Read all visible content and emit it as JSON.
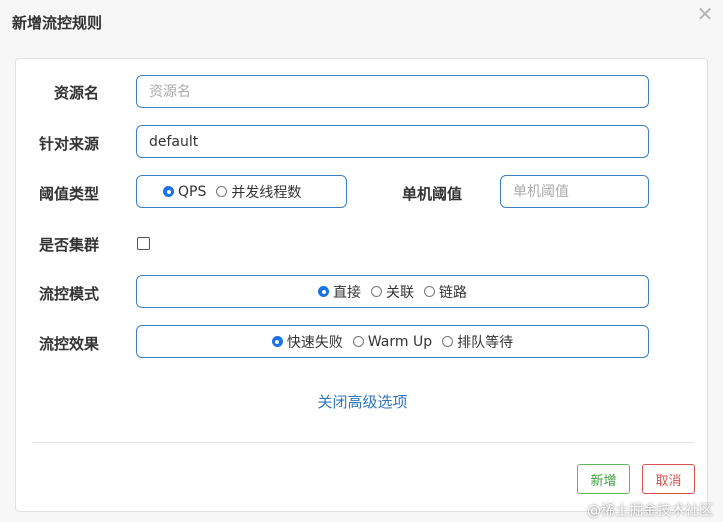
{
  "dialog": {
    "title": "新增流控规则",
    "close_icon": "close-icon"
  },
  "form": {
    "resource_name": {
      "label": "资源名",
      "value": "",
      "placeholder": "资源名"
    },
    "limit_app": {
      "label": "针对来源",
      "value": "default"
    },
    "threshold_type": {
      "label": "阈值类型",
      "options": [
        "QPS",
        "并发线程数"
      ],
      "selected": "QPS"
    },
    "single_threshold": {
      "label": "单机阈值",
      "value": "",
      "placeholder": "单机阈值"
    },
    "cluster": {
      "label": "是否集群",
      "checked": false
    },
    "control_mode": {
      "label": "流控模式",
      "options": [
        "直接",
        "关联",
        "链路"
      ],
      "selected": "直接"
    },
    "control_effect": {
      "label": "流控效果",
      "options": [
        "快速失败",
        "Warm Up",
        "排队等待"
      ],
      "selected": "快速失败"
    },
    "advanced_toggle": "关闭高级选项"
  },
  "footer": {
    "add_label": "新增",
    "cancel_label": "取消"
  },
  "watermark": "@稀土掘金技术社区",
  "colors": {
    "input_border": "#3a7fc4",
    "radio_checked": "#1a73e8",
    "link": "#2f76bd",
    "add_button": "#5cb85c",
    "cancel_button": "#d9534f"
  }
}
